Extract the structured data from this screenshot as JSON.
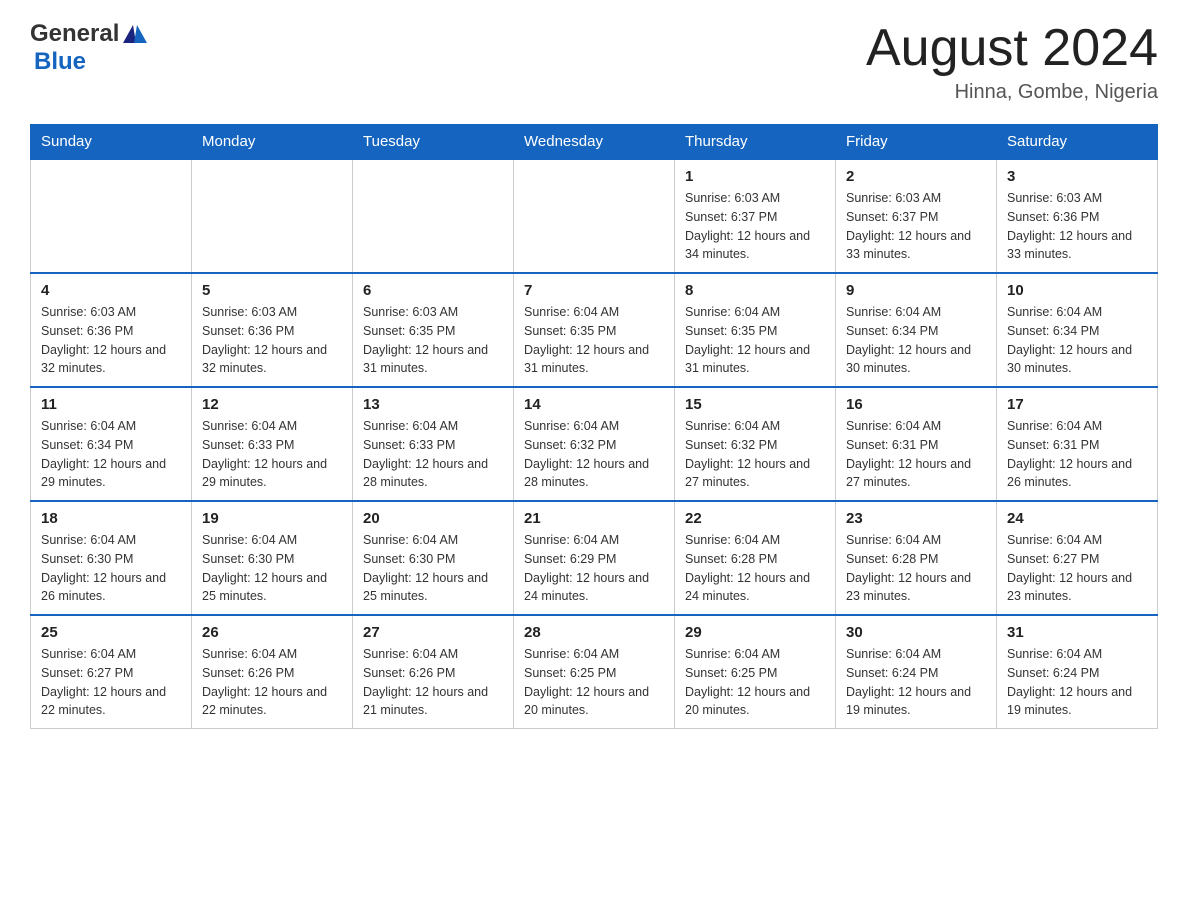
{
  "header": {
    "logo_general": "General",
    "logo_blue": "Blue",
    "title": "August 2024",
    "subtitle": "Hinna, Gombe, Nigeria"
  },
  "weekdays": [
    "Sunday",
    "Monday",
    "Tuesday",
    "Wednesday",
    "Thursday",
    "Friday",
    "Saturday"
  ],
  "weeks": [
    [
      {
        "day": "",
        "info": ""
      },
      {
        "day": "",
        "info": ""
      },
      {
        "day": "",
        "info": ""
      },
      {
        "day": "",
        "info": ""
      },
      {
        "day": "1",
        "info": "Sunrise: 6:03 AM\nSunset: 6:37 PM\nDaylight: 12 hours and 34 minutes."
      },
      {
        "day": "2",
        "info": "Sunrise: 6:03 AM\nSunset: 6:37 PM\nDaylight: 12 hours and 33 minutes."
      },
      {
        "day": "3",
        "info": "Sunrise: 6:03 AM\nSunset: 6:36 PM\nDaylight: 12 hours and 33 minutes."
      }
    ],
    [
      {
        "day": "4",
        "info": "Sunrise: 6:03 AM\nSunset: 6:36 PM\nDaylight: 12 hours and 32 minutes."
      },
      {
        "day": "5",
        "info": "Sunrise: 6:03 AM\nSunset: 6:36 PM\nDaylight: 12 hours and 32 minutes."
      },
      {
        "day": "6",
        "info": "Sunrise: 6:03 AM\nSunset: 6:35 PM\nDaylight: 12 hours and 31 minutes."
      },
      {
        "day": "7",
        "info": "Sunrise: 6:04 AM\nSunset: 6:35 PM\nDaylight: 12 hours and 31 minutes."
      },
      {
        "day": "8",
        "info": "Sunrise: 6:04 AM\nSunset: 6:35 PM\nDaylight: 12 hours and 31 minutes."
      },
      {
        "day": "9",
        "info": "Sunrise: 6:04 AM\nSunset: 6:34 PM\nDaylight: 12 hours and 30 minutes."
      },
      {
        "day": "10",
        "info": "Sunrise: 6:04 AM\nSunset: 6:34 PM\nDaylight: 12 hours and 30 minutes."
      }
    ],
    [
      {
        "day": "11",
        "info": "Sunrise: 6:04 AM\nSunset: 6:34 PM\nDaylight: 12 hours and 29 minutes."
      },
      {
        "day": "12",
        "info": "Sunrise: 6:04 AM\nSunset: 6:33 PM\nDaylight: 12 hours and 29 minutes."
      },
      {
        "day": "13",
        "info": "Sunrise: 6:04 AM\nSunset: 6:33 PM\nDaylight: 12 hours and 28 minutes."
      },
      {
        "day": "14",
        "info": "Sunrise: 6:04 AM\nSunset: 6:32 PM\nDaylight: 12 hours and 28 minutes."
      },
      {
        "day": "15",
        "info": "Sunrise: 6:04 AM\nSunset: 6:32 PM\nDaylight: 12 hours and 27 minutes."
      },
      {
        "day": "16",
        "info": "Sunrise: 6:04 AM\nSunset: 6:31 PM\nDaylight: 12 hours and 27 minutes."
      },
      {
        "day": "17",
        "info": "Sunrise: 6:04 AM\nSunset: 6:31 PM\nDaylight: 12 hours and 26 minutes."
      }
    ],
    [
      {
        "day": "18",
        "info": "Sunrise: 6:04 AM\nSunset: 6:30 PM\nDaylight: 12 hours and 26 minutes."
      },
      {
        "day": "19",
        "info": "Sunrise: 6:04 AM\nSunset: 6:30 PM\nDaylight: 12 hours and 25 minutes."
      },
      {
        "day": "20",
        "info": "Sunrise: 6:04 AM\nSunset: 6:30 PM\nDaylight: 12 hours and 25 minutes."
      },
      {
        "day": "21",
        "info": "Sunrise: 6:04 AM\nSunset: 6:29 PM\nDaylight: 12 hours and 24 minutes."
      },
      {
        "day": "22",
        "info": "Sunrise: 6:04 AM\nSunset: 6:28 PM\nDaylight: 12 hours and 24 minutes."
      },
      {
        "day": "23",
        "info": "Sunrise: 6:04 AM\nSunset: 6:28 PM\nDaylight: 12 hours and 23 minutes."
      },
      {
        "day": "24",
        "info": "Sunrise: 6:04 AM\nSunset: 6:27 PM\nDaylight: 12 hours and 23 minutes."
      }
    ],
    [
      {
        "day": "25",
        "info": "Sunrise: 6:04 AM\nSunset: 6:27 PM\nDaylight: 12 hours and 22 minutes."
      },
      {
        "day": "26",
        "info": "Sunrise: 6:04 AM\nSunset: 6:26 PM\nDaylight: 12 hours and 22 minutes."
      },
      {
        "day": "27",
        "info": "Sunrise: 6:04 AM\nSunset: 6:26 PM\nDaylight: 12 hours and 21 minutes."
      },
      {
        "day": "28",
        "info": "Sunrise: 6:04 AM\nSunset: 6:25 PM\nDaylight: 12 hours and 20 minutes."
      },
      {
        "day": "29",
        "info": "Sunrise: 6:04 AM\nSunset: 6:25 PM\nDaylight: 12 hours and 20 minutes."
      },
      {
        "day": "30",
        "info": "Sunrise: 6:04 AM\nSunset: 6:24 PM\nDaylight: 12 hours and 19 minutes."
      },
      {
        "day": "31",
        "info": "Sunrise: 6:04 AM\nSunset: 6:24 PM\nDaylight: 12 hours and 19 minutes."
      }
    ]
  ]
}
